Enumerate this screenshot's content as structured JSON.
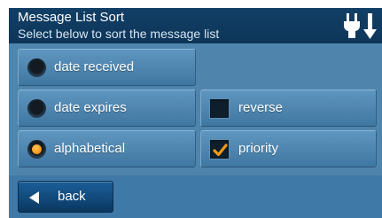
{
  "header": {
    "title": "Message List Sort",
    "subtitle": "Select below to sort the message list",
    "icon": "power-plug-icon"
  },
  "sort_options": [
    {
      "label": "date received",
      "selected": false
    },
    {
      "label": "date expires",
      "selected": false
    },
    {
      "label": "alphabetical",
      "selected": true
    }
  ],
  "toggles": [
    {
      "label": "reverse",
      "checked": false
    },
    {
      "label": "priority",
      "checked": true
    }
  ],
  "footer": {
    "back_label": "back"
  },
  "colors": {
    "header_bg": "#0d3558",
    "panel_bg": "#4f85ac",
    "button_bg": "#4f87b2",
    "accent_orange": "#f19a1a",
    "back_button_bg": "#124a7c"
  }
}
